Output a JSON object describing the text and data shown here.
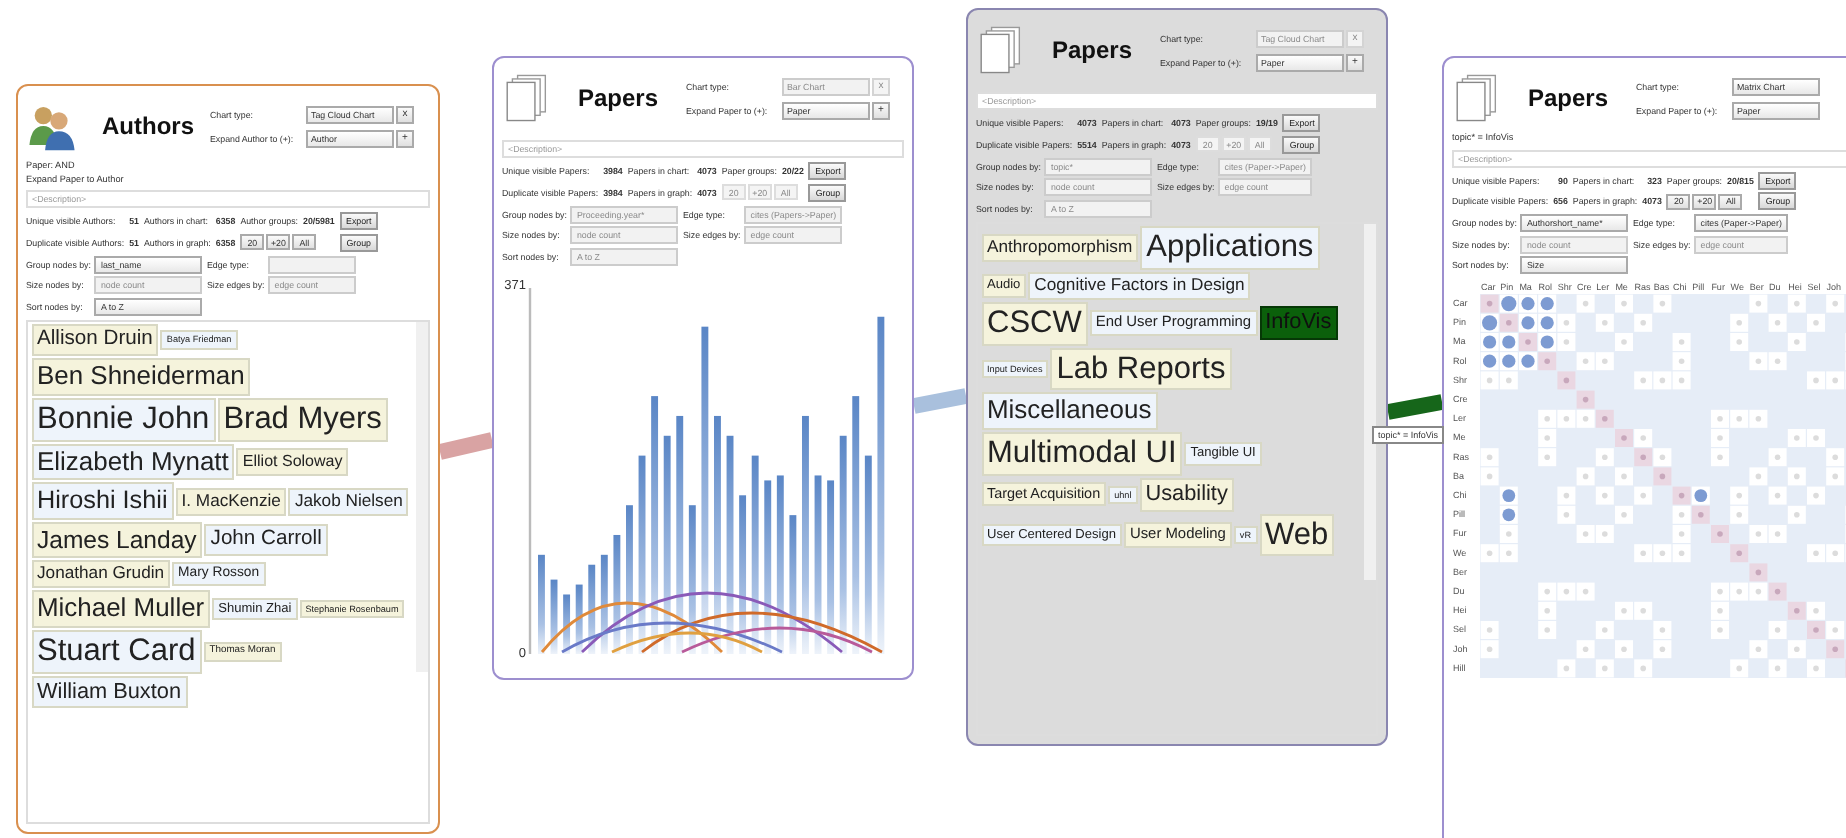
{
  "panels": [
    {
      "title": "Authors",
      "chart_type": {
        "label": "Chart type:",
        "value": "Tag Cloud Chart",
        "disabled": false
      },
      "close": {
        "label": "x",
        "disabled": false
      },
      "expand": {
        "label": "Expand Author to (+):",
        "value": "Author"
      },
      "add": "+",
      "notes": [
        "Paper: AND",
        "Expand Paper to Author"
      ],
      "description": "<Description>",
      "stats": [
        {
          "cells": [
            "Unique visible Authors:",
            "51",
            "Authors in chart:",
            "6358",
            "Author groups:",
            "20/5981"
          ],
          "button": "Export"
        },
        {
          "cells": [
            "Duplicate visible Authors:",
            "51",
            "Authors in graph:",
            "6358"
          ],
          "button": "Group"
        }
      ],
      "paging": [
        {
          "label": "20",
          "disabled": false
        },
        {
          "label": "+20",
          "disabled": false
        },
        {
          "label": "All",
          "disabled": false
        }
      ],
      "option_rows": [
        [
          {
            "label": "Group nodes by:",
            "value": "last_name",
            "disabled": false
          },
          {
            "label": "Edge type:",
            "disabled": true
          }
        ],
        [
          {
            "label": "Size nodes by:",
            "value": "node count",
            "disabled": true
          },
          {
            "label": "Size edges by:",
            "value": "edge count",
            "disabled": true
          }
        ],
        [
          {
            "label": "Sort nodes by:",
            "value": "A to Z",
            "disabled": false
          }
        ]
      ],
      "content": {
        "kind": "tagcloud",
        "tags": [
          {
            "text": "Allison Druin",
            "color": "#f5f3dc",
            "selected": false
          },
          {
            "text": "Batya Friedman",
            "color": "#eef4fb",
            "selected": false
          },
          {
            "text": "Ben Shneiderman",
            "color": "#f5f3dc",
            "selected": false
          },
          {
            "text": "Bonnie John",
            "color": "#eef4fb",
            "selected": false
          },
          {
            "text": "Brad Myers",
            "color": "#f5f3dc",
            "selected": false
          },
          {
            "text": "Elizabeth Mynatt",
            "color": "#eef4fb",
            "selected": false
          },
          {
            "text": "Elliot Soloway",
            "color": "#f5f3dc",
            "selected": false
          },
          {
            "text": "Hiroshi Ishii",
            "color": "#eef4fb",
            "selected": false
          },
          {
            "text": "I. MacKenzie",
            "color": "#f5f3dc",
            "selected": false
          },
          {
            "text": "Jakob Nielsen",
            "color": "#eef4fb",
            "selected": false
          },
          {
            "text": "James Landay",
            "color": "#f5f3dc",
            "selected": false
          },
          {
            "text": "John Carroll",
            "color": "#eef4fb",
            "selected": false
          },
          {
            "text": "Jonathan Grudin",
            "color": "#f5f3dc",
            "selected": false
          },
          {
            "text": "Mary Rosson",
            "color": "#eef4fb",
            "selected": false
          },
          {
            "text": "Michael Muller",
            "color": "#f5f3dc",
            "selected": false
          },
          {
            "text": "Shumin Zhai",
            "color": "#eef4fb",
            "selected": false
          },
          {
            "text": "Stephanie Rosenbaum",
            "color": "#f5f3dc",
            "selected": false
          },
          {
            "text": "Stuart Card",
            "color": "#eef4fb",
            "selected": false
          },
          {
            "text": "Thomas Moran",
            "color": "#f5f3dc",
            "selected": false
          },
          {
            "text": "William Buxton",
            "color": "#eef4fb",
            "selected": false
          }
        ]
      }
    },
    {
      "title": "Papers",
      "chart_type": {
        "label": "Chart type:",
        "value": "Bar Chart",
        "disabled": true
      },
      "close": {
        "label": "x",
        "disabled": true
      },
      "expand": {
        "label": "Expand Paper to (+):",
        "value": "Paper"
      },
      "add": "+",
      "description": "<Description>",
      "stats": [
        {
          "cells": [
            "Unique visible Papers:",
            "3984",
            "Papers in chart:",
            "4073",
            "Paper groups:",
            "20/22"
          ],
          "button": "Export"
        },
        {
          "cells": [
            "Duplicate visible Papers:",
            "3984",
            "Papers in graph:",
            "4073"
          ],
          "button": "Group"
        }
      ],
      "paging": [
        {
          "label": "20",
          "disabled": true
        },
        {
          "label": "+20",
          "disabled": true
        },
        {
          "label": "All",
          "disabled": true
        }
      ],
      "option_rows": [
        [
          {
            "label": "Group nodes by:",
            "value": "Proceeding.year*",
            "disabled": true
          },
          {
            "label": "Edge type:",
            "value": "cites (Papers->Paper)",
            "disabled": true
          }
        ],
        [
          {
            "label": "Size nodes by:",
            "value": "node count",
            "disabled": true
          },
          {
            "label": "Size edges by:",
            "value": "edge count",
            "disabled": true
          }
        ],
        [
          {
            "label": "Sort nodes by:",
            "value": "A to Z",
            "disabled": true
          }
        ]
      ],
      "content": {
        "kind": "bar",
        "axis_labels": [
          "371",
          "0"
        ]
      }
    },
    {
      "title": "Papers",
      "chart_type": {
        "label": "Chart type:",
        "value": "Tag Cloud Chart",
        "disabled": true
      },
      "close": {
        "label": "x",
        "disabled": true
      },
      "expand": {
        "label": "Expand Paper to (+):",
        "value": "Paper"
      },
      "add": "+",
      "description": "<Description>",
      "stats": [
        {
          "cells": [
            "Unique visible Papers:",
            "4073",
            "Papers in chart:",
            "4073",
            "Paper groups:",
            "19/19"
          ],
          "button": "Export"
        },
        {
          "cells": [
            "Duplicate visible Papers:",
            "5514",
            "Papers in graph:",
            "4073"
          ],
          "button": "Group"
        }
      ],
      "paging": [
        {
          "label": "20",
          "disabled": true
        },
        {
          "label": "+20",
          "disabled": true
        },
        {
          "label": "All",
          "disabled": true
        }
      ],
      "option_rows": [
        [
          {
            "label": "Group nodes by:",
            "value": "topic*",
            "disabled": true
          },
          {
            "label": "Edge type:",
            "value": "cites (Paper->Paper)",
            "disabled": true
          }
        ],
        [
          {
            "label": "Size nodes by:",
            "value": "node count",
            "disabled": true
          },
          {
            "label": "Size edges by:",
            "value": "edge count",
            "disabled": true
          }
        ],
        [
          {
            "label": "Sort nodes by:",
            "value": "A to Z",
            "disabled": true
          }
        ]
      ],
      "content": {
        "kind": "tagcloud",
        "tags": [
          {
            "text": "Anthropomorphism",
            "color": "#f5f3dc",
            "selected": false
          },
          {
            "text": "Applications",
            "color": "#eef4fb",
            "selected": false
          },
          {
            "text": "Audio",
            "color": "#f5f3dc",
            "selected": false
          },
          {
            "text": "Cognitive Factors in Design",
            "color": "#eef4fb",
            "selected": false
          },
          {
            "text": "CSCW",
            "color": "#f5f3dc",
            "selected": false
          },
          {
            "text": "End User Programming",
            "color": "#eef4fb",
            "selected": false
          },
          {
            "text": "InfoVis",
            "color": "#0b600b",
            "selected": true
          },
          {
            "text": "Input Devices",
            "color": "#eef4fb",
            "selected": false
          },
          {
            "text": "Lab Reports",
            "color": "#f5f3dc",
            "selected": false
          },
          {
            "text": "Miscellaneous",
            "color": "#eef4fb",
            "selected": false
          },
          {
            "text": "Multimodal UI",
            "color": "#f5f3dc",
            "selected": false
          },
          {
            "text": "Tangible UI",
            "color": "#eef4fb",
            "selected": false
          },
          {
            "text": "Target Acquisition",
            "color": "#f5f3dc",
            "selected": false
          },
          {
            "text": "uhnl",
            "color": "#eef4fb",
            "selected": false
          },
          {
            "text": "Usability",
            "color": "#f5f3dc",
            "selected": false
          },
          {
            "text": "User Centered Design",
            "color": "#eef4fb",
            "selected": false
          },
          {
            "text": "User Modeling",
            "color": "#f5f3dc",
            "selected": false
          },
          {
            "text": "vR",
            "color": "#eef4fb",
            "selected": false
          },
          {
            "text": "Web",
            "color": "#f5f3dc",
            "selected": false
          }
        ]
      }
    },
    {
      "title": "Papers",
      "chart_type": {
        "label": "Chart type:",
        "value": "Matrix Chart",
        "disabled": false
      },
      "expand": {
        "label": "Expand Paper to (+):",
        "value": "Paper"
      },
      "notes": [
        "topic* = InfoVis"
      ],
      "description": "<Description>",
      "stats": [
        {
          "cells": [
            "Unique visible Papers:",
            "90",
            "Papers in chart:",
            "323",
            "Paper groups:",
            "20/815"
          ],
          "button": "Export"
        },
        {
          "cells": [
            "Duplicate visible Papers:",
            "656",
            "Papers in graph:",
            "4073"
          ],
          "button": "Group"
        }
      ],
      "paging": [
        {
          "label": "20",
          "disabled": false
        },
        {
          "label": "+20",
          "disabled": false
        },
        {
          "label": "All",
          "disabled": false
        }
      ],
      "option_rows": [
        [
          {
            "label": "Group nodes by:",
            "value": "Authorshort_name*",
            "disabled": false
          },
          {
            "label": "Edge type:",
            "value": "cites (Paper->Paper)",
            "disabled": false
          }
        ],
        [
          {
            "label": "Size nodes by:",
            "value": "node count",
            "disabled": true
          },
          {
            "label": "Size edges by:",
            "value": "edge count",
            "disabled": true
          }
        ],
        [
          {
            "label": "Sort nodes by:",
            "value": "Size",
            "disabled": false
          }
        ]
      ],
      "content": {
        "kind": "matrix",
        "columns": [
          "Car",
          "Pin",
          "Ma",
          "Rol",
          "Shr",
          "Cre",
          "Ler",
          "Me",
          "Ras",
          "Bas",
          "Chi",
          "Pill",
          "Fur",
          "We",
          "Ber",
          "Du",
          "Hei",
          "Sel",
          "Joh"
        ],
        "rows": [
          "Car",
          "Pin",
          "Ma",
          "Rol",
          "Shr",
          "Cre",
          "Ler",
          "Me",
          "Ras",
          "Ba",
          "Chi",
          "Pill",
          "Fur",
          "We",
          "Ber",
          "Du",
          "Hei",
          "Sel",
          "Joh",
          "Hill"
        ]
      }
    }
  ],
  "links": [
    {
      "color": "#d9a3a3"
    },
    {
      "color": "#a9c0dd"
    },
    {
      "color": "#16661a"
    }
  ],
  "tooltip": "topic* = InfoVis"
}
